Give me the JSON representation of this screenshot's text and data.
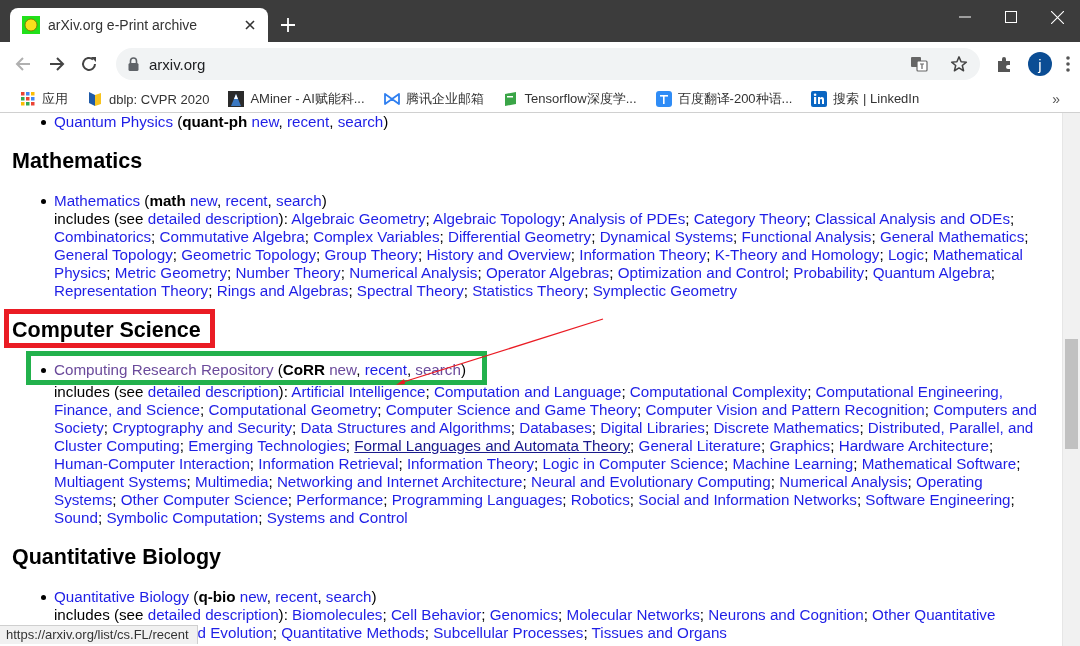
{
  "browser": {
    "tab": {
      "title": "arXiv.org e-Print archive",
      "selected": true
    },
    "address": "arxiv.org",
    "profile_initial": "j",
    "bookmarks": [
      {
        "kind": "apps",
        "label": "应用"
      },
      {
        "kind": "dblp",
        "label": "dblp: CVPR 2020"
      },
      {
        "kind": "aminer",
        "label": "AMiner - AI赋能科..."
      },
      {
        "kind": "tencent",
        "label": "腾讯企业邮箱"
      },
      {
        "kind": "tensorflow",
        "label": "Tensorflow深度学..."
      },
      {
        "kind": "baidu",
        "label": "百度翻译-200种语..."
      },
      {
        "kind": "linkedin",
        "label": "搜索 | LinkedIn"
      }
    ],
    "bookmarks_overflow": "»"
  },
  "page": {
    "top_entry": {
      "segments": [
        {
          "kind": "link",
          "text": "Quantum Physics",
          "visited": false
        },
        {
          "kind": "plain",
          "text": " ("
        },
        {
          "kind": "code",
          "text": "quant-ph "
        },
        {
          "kind": "link",
          "text": "new",
          "visited": false
        },
        {
          "kind": "plain",
          "text": ", "
        },
        {
          "kind": "link",
          "text": "recent",
          "visited": false
        },
        {
          "kind": "plain",
          "text": ", "
        },
        {
          "kind": "link",
          "text": "search",
          "visited": false
        },
        {
          "kind": "plain",
          "text": ")"
        }
      ]
    },
    "sections": [
      {
        "heading": "Mathematics",
        "boxed": false,
        "entry": {
          "boxed": false,
          "segments": [
            {
              "kind": "link",
              "text": "Mathematics",
              "visited": false
            },
            {
              "kind": "plain",
              "text": " ("
            },
            {
              "kind": "code",
              "text": "math "
            },
            {
              "kind": "link",
              "text": "new",
              "visited": false
            },
            {
              "kind": "plain",
              "text": ", "
            },
            {
              "kind": "link",
              "text": "recent",
              "visited": false
            },
            {
              "kind": "plain",
              "text": ", "
            },
            {
              "kind": "link",
              "text": "search",
              "visited": false
            },
            {
              "kind": "plain",
              "text": ")"
            }
          ],
          "includes": {
            "prefix": "includes (see ",
            "link": "detailed description",
            "after": "): ",
            "separator": "; ",
            "topics": [
              {
                "text": "Algebraic Geometry",
                "hovered": false
              },
              {
                "text": "Algebraic Topology",
                "hovered": false
              },
              {
                "text": "Analysis of PDEs",
                "hovered": false
              },
              {
                "text": "Category Theory",
                "hovered": false
              },
              {
                "text": "Classical Analysis and ODEs",
                "hovered": false
              },
              {
                "text": "Combinatorics",
                "hovered": false
              },
              {
                "text": "Commutative Algebra",
                "hovered": false
              },
              {
                "text": "Complex Variables",
                "hovered": false
              },
              {
                "text": "Differential Geometry",
                "hovered": false
              },
              {
                "text": "Dynamical Systems",
                "hovered": false
              },
              {
                "text": "Functional Analysis",
                "hovered": false
              },
              {
                "text": "General Mathematics",
                "hovered": false
              },
              {
                "text": "General Topology",
                "hovered": false
              },
              {
                "text": "Geometric Topology",
                "hovered": false
              },
              {
                "text": "Group Theory",
                "hovered": false
              },
              {
                "text": "History and Overview",
                "hovered": false
              },
              {
                "text": "Information Theory",
                "hovered": false
              },
              {
                "text": "K-Theory and Homology",
                "hovered": false
              },
              {
                "text": "Logic",
                "hovered": false
              },
              {
                "parts": [
                  "Mathematical",
                  "Physics"
                ],
                "hovered": false
              },
              {
                "text": "Metric Geometry",
                "hovered": false
              },
              {
                "text": "Number Theory",
                "hovered": false
              },
              {
                "text": "Numerical Analysis",
                "hovered": false
              },
              {
                "text": "Operator Algebras",
                "hovered": false
              },
              {
                "text": "Optimization and Control",
                "hovered": false
              },
              {
                "text": "Probability",
                "hovered": false
              },
              {
                "text": "Quantum Algebra",
                "hovered": false
              },
              {
                "text": "Representation Theory",
                "hovered": false
              },
              {
                "text": "Rings and Algebras",
                "hovered": false
              },
              {
                "text": "Spectral Theory",
                "hovered": false
              },
              {
                "text": "Statistics Theory",
                "hovered": false
              },
              {
                "text": "Symplectic Geometry",
                "hovered": false
              }
            ]
          }
        }
      },
      {
        "heading": "Computer Science",
        "boxed": true,
        "entry": {
          "boxed": true,
          "segments": [
            {
              "kind": "link",
              "text": "Computing Research Repository",
              "visited": true
            },
            {
              "kind": "plain",
              "text": " ("
            },
            {
              "kind": "code",
              "text": "CoRR "
            },
            {
              "kind": "link",
              "text": "new",
              "visited": true
            },
            {
              "kind": "plain",
              "text": ", "
            },
            {
              "kind": "link",
              "text": "recent",
              "visited": false
            },
            {
              "kind": "plain",
              "text": ", "
            },
            {
              "kind": "link",
              "text": "search",
              "visited": true
            },
            {
              "kind": "plain",
              "text": ")"
            }
          ],
          "includes": {
            "prefix": "includes (see ",
            "link": "detailed description",
            "after": "): ",
            "separator": "; ",
            "topics": [
              {
                "text": "Artificial Intelligence",
                "hovered": false
              },
              {
                "text": "Computation and Language",
                "hovered": false
              },
              {
                "text": "Computational Complexity",
                "hovered": false
              },
              {
                "parts": [
                  "Computational Engineering,",
                  "Finance, and Science"
                ],
                "hovered": false
              },
              {
                "text": "Computational Geometry",
                "hovered": false
              },
              {
                "text": "Computer Science and Game Theory",
                "hovered": false
              },
              {
                "text": "Computer Vision and Pattern Recognition",
                "hovered": false
              },
              {
                "parts": [
                  "Computers and",
                  "Society"
                ],
                "hovered": false
              },
              {
                "text": "Cryptography and Security",
                "hovered": false
              },
              {
                "text": "Data Structures and Algorithms",
                "hovered": false
              },
              {
                "text": "Databases",
                "hovered": false
              },
              {
                "text": "Digital Libraries",
                "hovered": false
              },
              {
                "text": "Discrete Mathematics",
                "hovered": false
              },
              {
                "parts": [
                  "Distributed, Parallel, and",
                  "Cluster Computing"
                ],
                "hovered": false
              },
              {
                "text": "Emerging Technologies",
                "hovered": false
              },
              {
                "text": "Formal Languages and Automata Theory",
                "hovered": true
              },
              {
                "text": "General Literature",
                "hovered": false
              },
              {
                "text": "Graphics",
                "hovered": false
              },
              {
                "text": "Hardware Architecture",
                "hovered": false
              },
              {
                "text": "Human-Computer Interaction",
                "hovered": false
              },
              {
                "text": "Information Retrieval",
                "hovered": false
              },
              {
                "text": "Information Theory",
                "hovered": false
              },
              {
                "text": "Logic in Computer Science",
                "hovered": false
              },
              {
                "text": "Machine Learning",
                "hovered": false
              },
              {
                "text": "Mathematical Software",
                "hovered": false
              },
              {
                "text": "Multiagent Systems",
                "hovered": false
              },
              {
                "text": "Multimedia",
                "hovered": false
              },
              {
                "text": "Networking and Internet Architecture",
                "hovered": false
              },
              {
                "text": "Neural and Evolutionary Computing",
                "hovered": false
              },
              {
                "text": "Numerical Analysis",
                "hovered": false
              },
              {
                "parts": [
                  "Operating",
                  "Systems"
                ],
                "hovered": false
              },
              {
                "text": "Other Computer Science",
                "hovered": false
              },
              {
                "text": "Performance",
                "hovered": false
              },
              {
                "text": "Programming Languages",
                "hovered": false
              },
              {
                "text": "Robotics",
                "hovered": false
              },
              {
                "text": "Social and Information Networks",
                "hovered": false
              },
              {
                "text": "Software Engineering",
                "hovered": false
              },
              {
                "text": "Sound",
                "hovered": false
              },
              {
                "text": "Symbolic Computation",
                "hovered": false
              },
              {
                "text": "Systems and Control",
                "hovered": false
              }
            ]
          }
        }
      },
      {
        "heading": "Quantitative Biology",
        "boxed": false,
        "entry": {
          "boxed": false,
          "segments": [
            {
              "kind": "link",
              "text": "Quantitative Biology",
              "visited": false
            },
            {
              "kind": "plain",
              "text": " ("
            },
            {
              "kind": "code",
              "text": "q-bio "
            },
            {
              "kind": "link",
              "text": "new",
              "visited": false
            },
            {
              "kind": "plain",
              "text": ", "
            },
            {
              "kind": "link",
              "text": "recent",
              "visited": false
            },
            {
              "kind": "plain",
              "text": ", "
            },
            {
              "kind": "link",
              "text": "search",
              "visited": false
            },
            {
              "kind": "plain",
              "text": ")"
            }
          ],
          "includes": {
            "prefix": "includes (see ",
            "link": "detailed description",
            "after": "): ",
            "separator": "; ",
            "topics": [
              {
                "text": "Biomolecules",
                "hovered": false
              },
              {
                "text": "Cell Behavior",
                "hovered": false
              },
              {
                "text": "Genomics",
                "hovered": false
              },
              {
                "text": "Molecular Networks",
                "hovered": false
              },
              {
                "text": "Neurons and Cognition",
                "hovered": false
              },
              {
                "text": "Other Quantitative",
                "hovered": false
              }
            ],
            "continuation": [
              {
                "text": "d Evolution",
                "hovered": false
              },
              {
                "text": "Quantitative Methods",
                "hovered": false
              },
              {
                "text": "Subcellular Processes",
                "hovered": false
              },
              {
                "text": "Tissues and Organs",
                "hovered": false
              }
            ]
          }
        }
      }
    ]
  },
  "status_bar": {
    "text": "https://arxiv.org/list/cs.FL/recent"
  }
}
